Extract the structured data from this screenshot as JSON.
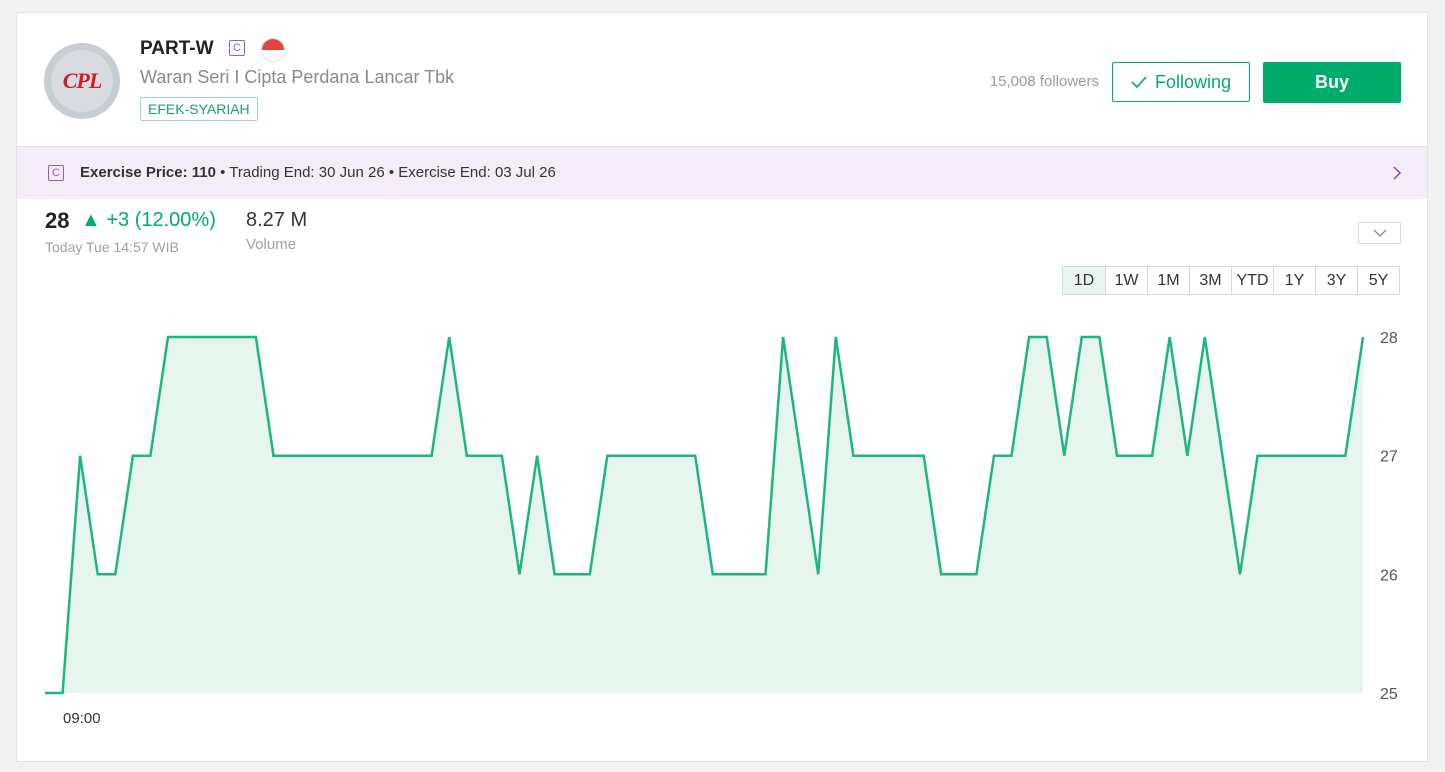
{
  "header": {
    "logo_text": "CPL",
    "ticker": "PART-W",
    "badge": "C",
    "company_name": "Waran Seri I Cipta Perdana Lancar Tbk",
    "tag": "EFEK-SYARIAH",
    "followers": "15,008 followers",
    "following_label": "Following",
    "buy_label": "Buy"
  },
  "infobar": {
    "badge": "C",
    "exercise_label": "Exercise Price:",
    "exercise_value": "110",
    "trading_end": "• Trading End: 30 Jun 26",
    "exercise_end": "• Exercise End: 03 Jul 26"
  },
  "quote": {
    "price": "28",
    "change": "▲ +3 (12.00%)",
    "timestamp": "Today Tue 14:57 WIB",
    "volume": "8.27 M",
    "volume_label": "Volume"
  },
  "periods": [
    "1D",
    "1W",
    "1M",
    "3M",
    "YTD",
    "1Y",
    "3Y",
    "5Y"
  ],
  "active_period": "1D",
  "colors": {
    "accent": "#00ab6b",
    "line": "#1db77e",
    "fill": "#e6f6ef"
  },
  "chart_data": {
    "type": "area",
    "x_start_label": "09:00",
    "y_ticks": [
      25,
      26,
      27,
      28
    ],
    "ylim": [
      25,
      28
    ],
    "values": [
      25,
      25,
      27,
      26,
      26,
      27,
      27,
      28,
      28,
      28,
      28,
      28,
      28,
      27,
      27,
      27,
      27,
      27,
      27,
      27,
      27,
      27,
      27,
      28,
      27,
      27,
      27,
      26,
      27,
      26,
      26,
      26,
      27,
      27,
      27,
      27,
      27,
      27,
      26,
      26,
      26,
      26,
      28,
      27,
      26,
      28,
      27,
      27,
      27,
      27,
      27,
      26,
      26,
      26,
      27,
      27,
      28,
      28,
      27,
      28,
      28,
      27,
      27,
      27,
      28,
      27,
      28,
      27,
      26,
      27,
      27,
      27,
      27,
      27,
      27,
      28
    ],
    "title": "",
    "xlabel": "",
    "ylabel": "",
    "grid": false
  }
}
